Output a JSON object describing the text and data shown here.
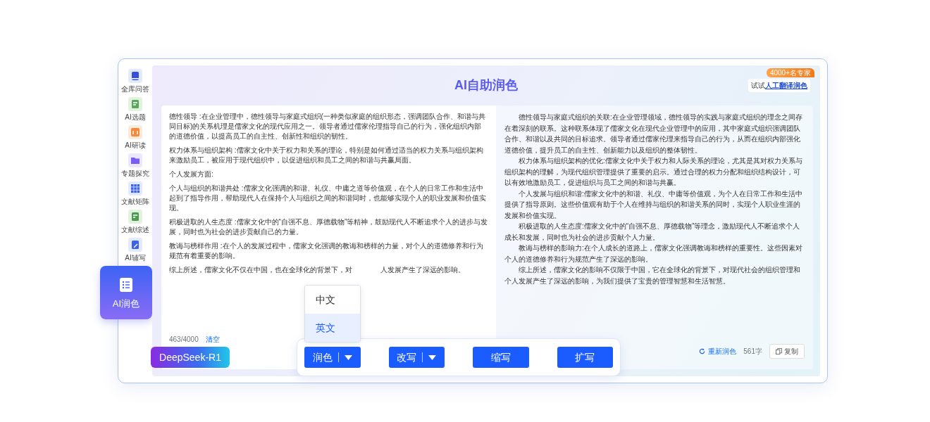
{
  "sidebar": {
    "items": [
      {
        "label": "全库问答",
        "selected": false
      },
      {
        "label": "AI选题",
        "selected": false
      },
      {
        "label": "AI研读",
        "selected": false
      },
      {
        "label": "专题探究",
        "selected": false
      },
      {
        "label": "文献矩阵",
        "selected": false
      },
      {
        "label": "文献综述",
        "selected": false
      },
      {
        "label": "AI辅写",
        "selected": false
      },
      {
        "label": "AI润色",
        "selected": true
      }
    ]
  },
  "header": {
    "title": "AI自助润色",
    "promo": {
      "badge": "4000+名专家",
      "prefix": "试试",
      "link": "人工翻译润色"
    }
  },
  "source": {
    "paragraphs": [
      [
        "德性领导 :在企业管理中，德性领导与家庭式组织(一种类似家庭的组织形态，强调团队合作、和谐与共同目标)的关系机理是儒家文化的现代应用之一。领导者通过儒家伦理指导自己的行为，强化组织内部的道德价值，以提高员工的自主性、创新性和组织的韧性。"
      ],
      [
        "权力体系与组织架构 :儒家文化中关于权力和关系的理论，特别是如何通过适当的权力关系与组织架构来激励员工，被应用于现代组织中，以促进组织和员工之间的和谐与共赢局面。"
      ],
      [
        "个人发展方面:"
      ],
      [
        "个人与组织的和谐共处 :儒家文化强调的和谐、礼仪、中庸之道等价值观，在个人的日常工作和生活中起到了指导作用，帮助现代人在保持个人与组织之间的和谐同时，也能够实现个人的职业发展和价值实现。"
      ],
      [
        "积极进取的人生态度 :儒家文化中的“自强不息、厚德载物”等精神，鼓励现代人不断追求个人的进步与发展，同时也为社会的进步贡献自己的力量。"
      ],
      [
        "教诲与榜样作用 :在个人的发展过程中，儒家文化强调的教诲和榜样的力量，对个人的道德修养和行为规范有着重要的影响。"
      ],
      [
        "综上所述，儒家文化不仅在中国，也在全球化的背景下，对",
        "人发展产生了深远的影响。"
      ]
    ],
    "counter": "463/4000",
    "clear": "清空"
  },
  "result": {
    "paragraphs": [
      "德性领导与家庭式组织的关联:在企业管理领域，德性领导的实践与家庭式组织的理念之间存在着深刻的联系。这种联系体现了儒家文化在现代企业管理中的应用，其中家庭式组织强调团队合作、和谐以及共同的目标追求。领导者通过儒家伦理来指导自己的行为，从而在组织内部强化道德价值，提升员工的自主性、创新能力以及组织的整体韧性。",
      "权力体系与组织架构的优化:儒家文化中关于权力和人际关系的理论，尤其是其对权力关系与组织架构的理解，为现代组织管理提供了重要的启示。通过合理的权力分配和组织结构设计，可以有效地激励员工，促进组织与员工之间的和谐与共赢。",
      "个人发展与组织和谐:儒家文化中的和谐、礼仪、中庸等价值观，为个人在日常工作和生活中提供了指导原则。这些价值观有助于个人在维持与组织的和谐关系的同时，实现个人职业生涯的发展和价值实现。",
      "积极进取的人生态度:儒家文化中的“自强不息、厚德载物”等理念，激励现代人不断追求个人成长和发展，同时也为社会的进步贡献个人力量。",
      "教诲与榜样的影响力:在个人成长的道路上，儒家文化强调教诲和榜样的重要性。这些因素对个人的道德修养和行为规范产生了深远的影响。",
      "综上所述，儒家文化的影响不仅限于中国，它在全球化的背景下，对现代社会的组织管理和个人发展产生了深远的影响，为我们提供了宝贵的管理智慧和生活智慧。"
    ],
    "regenerate": "重新润色",
    "word_count": "561字",
    "copy": "复制"
  },
  "model": "DeepSeek-R1",
  "toolbar": {
    "buttons": [
      {
        "label": "润色",
        "has_menu": true
      },
      {
        "label": "改写",
        "has_menu": true
      },
      {
        "label": "缩写",
        "has_menu": false
      },
      {
        "label": "扩写",
        "has_menu": false
      }
    ],
    "menu": {
      "options": [
        {
          "label": "中文",
          "selected": false
        },
        {
          "label": "英文",
          "selected": true
        }
      ]
    }
  }
}
